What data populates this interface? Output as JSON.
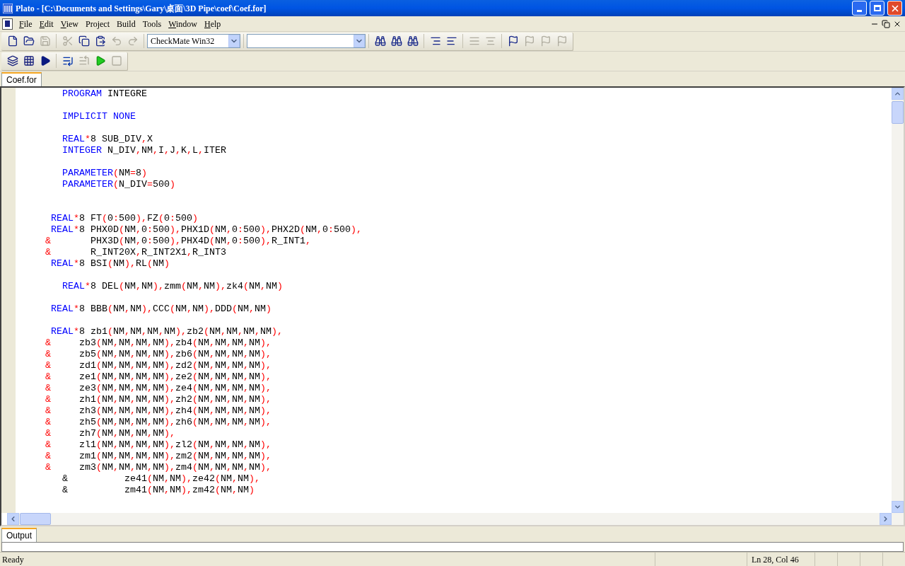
{
  "window": {
    "title": "Plato - [C:\\Documents and Settings\\Gary\\桌面\\3D Pipe\\coef\\Coef.for]"
  },
  "menu": [
    {
      "label": "File",
      "mnemonic": true
    },
    {
      "label": "Edit",
      "mnemonic": true
    },
    {
      "label": "View",
      "mnemonic": true
    },
    {
      "label": "Project",
      "mnemonic": false
    },
    {
      "label": "Build",
      "mnemonic": false
    },
    {
      "label": "Tools",
      "mnemonic": false
    },
    {
      "label": "Window",
      "mnemonic": true
    },
    {
      "label": "Help",
      "mnemonic": true
    }
  ],
  "toolbar_file": [
    {
      "disabled": false
    },
    {
      "disabled": false
    },
    {
      "disabled": true
    },
    {
      "disabled": true
    },
    {
      "disabled": false
    },
    {
      "disabled": false
    },
    {
      "disabled": true
    },
    {
      "disabled": true
    }
  ],
  "configuration_dropdown": {
    "value": "CheckMate Win32"
  },
  "toolbar_edit": [
    {
      "disabled": false
    },
    {
      "disabled": false
    },
    {
      "disabled": false
    },
    {
      "disabled": false
    },
    {
      "disabled": false
    },
    {
      "disabled": true
    },
    {
      "disabled": true
    },
    {
      "disabled": false
    },
    {
      "disabled": true
    },
    {
      "disabled": true
    },
    {
      "disabled": true
    }
  ],
  "toolbar_build": [
    {
      "disabled": false
    },
    {
      "disabled": false
    },
    {
      "disabled": false
    },
    {
      "disabled": false
    },
    {
      "disabled": true
    },
    {
      "disabled": false
    },
    {
      "disabled": true
    }
  ],
  "editor_tabs": [
    {
      "label": "Coef.for",
      "selected": true
    }
  ],
  "code_lines": [
    {
      "kind": "code",
      "tokens": [
        {
          "kind": "keyword",
          "text": "        PROGRAM"
        },
        {
          "kind": "name",
          "text": " INTEGRE"
        }
      ]
    },
    {
      "kind": "blank"
    },
    {
      "kind": "code",
      "tokens": [
        {
          "kind": "keyword",
          "text": "        IMPLICIT NONE"
        }
      ]
    },
    {
      "kind": "blank"
    },
    {
      "kind": "code",
      "tokens": [
        {
          "kind": "keyword",
          "text": "        REAL"
        },
        {
          "kind": "symbol",
          "text": "*"
        },
        {
          "kind": "name",
          "text": "8 SUB_DIV"
        },
        {
          "kind": "symbol",
          "text": ","
        },
        {
          "kind": "name",
          "text": "X"
        }
      ]
    },
    {
      "kind": "code",
      "tokens": [
        {
          "kind": "keyword",
          "text": "        INTEGER"
        },
        {
          "kind": "name",
          "text": " N_DIV"
        },
        {
          "kind": "symbol",
          "text": ","
        },
        {
          "kind": "name",
          "text": "NM"
        },
        {
          "kind": "symbol",
          "text": ","
        },
        {
          "kind": "name",
          "text": "I"
        },
        {
          "kind": "symbol",
          "text": ","
        },
        {
          "kind": "name",
          "text": "J"
        },
        {
          "kind": "symbol",
          "text": ","
        },
        {
          "kind": "name",
          "text": "K"
        },
        {
          "kind": "symbol",
          "text": ","
        },
        {
          "kind": "name",
          "text": "L"
        },
        {
          "kind": "symbol",
          "text": ","
        },
        {
          "kind": "name",
          "text": "ITER"
        }
      ]
    },
    {
      "kind": "blank"
    },
    {
      "kind": "code",
      "tokens": [
        {
          "kind": "keyword",
          "text": "        PARAMETER"
        },
        {
          "kind": "symbol",
          "text": "("
        },
        {
          "kind": "name",
          "text": "NM"
        },
        {
          "kind": "symbol",
          "text": "="
        },
        {
          "kind": "name",
          "text": "8"
        },
        {
          "kind": "symbol",
          "text": ")"
        }
      ]
    },
    {
      "kind": "code",
      "tokens": [
        {
          "kind": "keyword",
          "text": "        PARAMETER"
        },
        {
          "kind": "symbol",
          "text": "("
        },
        {
          "kind": "name",
          "text": "N_DIV"
        },
        {
          "kind": "symbol",
          "text": "="
        },
        {
          "kind": "name",
          "text": "500"
        },
        {
          "kind": "symbol",
          "text": ")"
        }
      ]
    },
    {
      "kind": "blank"
    },
    {
      "kind": "blank"
    },
    {
      "kind": "code",
      "tokens": [
        {
          "kind": "keyword",
          "text": "      REAL"
        },
        {
          "kind": "symbol",
          "text": "*"
        },
        {
          "kind": "name",
          "text": "8 FT"
        },
        {
          "kind": "symbol",
          "text": "("
        },
        {
          "kind": "name",
          "text": "0"
        },
        {
          "kind": "symbol",
          "text": ":"
        },
        {
          "kind": "name",
          "text": "500"
        },
        {
          "kind": "symbol",
          "text": "),"
        },
        {
          "kind": "name",
          "text": "FZ"
        },
        {
          "kind": "symbol",
          "text": "("
        },
        {
          "kind": "name",
          "text": "0"
        },
        {
          "kind": "symbol",
          "text": ":"
        },
        {
          "kind": "name",
          "text": "500"
        },
        {
          "kind": "symbol",
          "text": ")"
        }
      ]
    },
    {
      "kind": "code",
      "tokens": [
        {
          "kind": "keyword",
          "text": "      REAL"
        },
        {
          "kind": "symbol",
          "text": "*"
        },
        {
          "kind": "name",
          "text": "8 PHX0D"
        },
        {
          "kind": "symbol",
          "text": "("
        },
        {
          "kind": "name",
          "text": "NM"
        },
        {
          "kind": "symbol",
          "text": ","
        },
        {
          "kind": "name",
          "text": "0"
        },
        {
          "kind": "symbol",
          "text": ":"
        },
        {
          "kind": "name",
          "text": "500"
        },
        {
          "kind": "symbol",
          "text": "),"
        },
        {
          "kind": "name",
          "text": "PHX1D"
        },
        {
          "kind": "symbol",
          "text": "("
        },
        {
          "kind": "name",
          "text": "NM"
        },
        {
          "kind": "symbol",
          "text": ","
        },
        {
          "kind": "name",
          "text": "0"
        },
        {
          "kind": "symbol",
          "text": ":"
        },
        {
          "kind": "name",
          "text": "500"
        },
        {
          "kind": "symbol",
          "text": "),"
        },
        {
          "kind": "name",
          "text": "PHX2D"
        },
        {
          "kind": "symbol",
          "text": "("
        },
        {
          "kind": "name",
          "text": "NM"
        },
        {
          "kind": "symbol",
          "text": ","
        },
        {
          "kind": "name",
          "text": "0"
        },
        {
          "kind": "symbol",
          "text": ":"
        },
        {
          "kind": "name",
          "text": "500"
        },
        {
          "kind": "symbol",
          "text": "),"
        }
      ]
    },
    {
      "kind": "code",
      "tokens": [
        {
          "kind": "symbol",
          "text": "     &"
        },
        {
          "kind": "name",
          "text": "       PHX3D"
        },
        {
          "kind": "symbol",
          "text": "("
        },
        {
          "kind": "name",
          "text": "NM"
        },
        {
          "kind": "symbol",
          "text": ","
        },
        {
          "kind": "name",
          "text": "0"
        },
        {
          "kind": "symbol",
          "text": ":"
        },
        {
          "kind": "name",
          "text": "500"
        },
        {
          "kind": "symbol",
          "text": "),"
        },
        {
          "kind": "name",
          "text": "PHX4D"
        },
        {
          "kind": "symbol",
          "text": "("
        },
        {
          "kind": "name",
          "text": "NM"
        },
        {
          "kind": "symbol",
          "text": ","
        },
        {
          "kind": "name",
          "text": "0"
        },
        {
          "kind": "symbol",
          "text": ":"
        },
        {
          "kind": "name",
          "text": "500"
        },
        {
          "kind": "symbol",
          "text": "),"
        },
        {
          "kind": "name",
          "text": "R_INT1"
        },
        {
          "kind": "symbol",
          "text": ","
        }
      ]
    },
    {
      "kind": "code",
      "tokens": [
        {
          "kind": "symbol",
          "text": "     &"
        },
        {
          "kind": "name",
          "text": "       R_INT20X"
        },
        {
          "kind": "symbol",
          "text": ","
        },
        {
          "kind": "name",
          "text": "R_INT2X1"
        },
        {
          "kind": "symbol",
          "text": ","
        },
        {
          "kind": "name",
          "text": "R_INT3"
        }
      ]
    },
    {
      "kind": "code",
      "tokens": [
        {
          "kind": "keyword",
          "text": "      REAL"
        },
        {
          "kind": "symbol",
          "text": "*"
        },
        {
          "kind": "name",
          "text": "8 BSI"
        },
        {
          "kind": "symbol",
          "text": "("
        },
        {
          "kind": "name",
          "text": "NM"
        },
        {
          "kind": "symbol",
          "text": "),"
        },
        {
          "kind": "name",
          "text": "RL"
        },
        {
          "kind": "symbol",
          "text": "("
        },
        {
          "kind": "name",
          "text": "NM"
        },
        {
          "kind": "symbol",
          "text": ")"
        }
      ]
    },
    {
      "kind": "blank"
    },
    {
      "kind": "code",
      "tokens": [
        {
          "kind": "keyword",
          "text": "        REAL"
        },
        {
          "kind": "symbol",
          "text": "*"
        },
        {
          "kind": "name",
          "text": "8 DEL"
        },
        {
          "kind": "symbol",
          "text": "("
        },
        {
          "kind": "name",
          "text": "NM"
        },
        {
          "kind": "symbol",
          "text": ","
        },
        {
          "kind": "name",
          "text": "NM"
        },
        {
          "kind": "symbol",
          "text": "),"
        },
        {
          "kind": "name",
          "text": "zmm"
        },
        {
          "kind": "symbol",
          "text": "("
        },
        {
          "kind": "name",
          "text": "NM"
        },
        {
          "kind": "symbol",
          "text": ","
        },
        {
          "kind": "name",
          "text": "NM"
        },
        {
          "kind": "symbol",
          "text": "),"
        },
        {
          "kind": "name",
          "text": "zk4"
        },
        {
          "kind": "symbol",
          "text": "("
        },
        {
          "kind": "name",
          "text": "NM"
        },
        {
          "kind": "symbol",
          "text": ","
        },
        {
          "kind": "name",
          "text": "NM"
        },
        {
          "kind": "symbol",
          "text": ")"
        }
      ]
    },
    {
      "kind": "blank"
    },
    {
      "kind": "code",
      "tokens": [
        {
          "kind": "keyword",
          "text": "      REAL"
        },
        {
          "kind": "symbol",
          "text": "*"
        },
        {
          "kind": "name",
          "text": "8 BBB"
        },
        {
          "kind": "symbol",
          "text": "("
        },
        {
          "kind": "name",
          "text": "NM"
        },
        {
          "kind": "symbol",
          "text": ","
        },
        {
          "kind": "name",
          "text": "NM"
        },
        {
          "kind": "symbol",
          "text": "),"
        },
        {
          "kind": "name",
          "text": "CCC"
        },
        {
          "kind": "symbol",
          "text": "("
        },
        {
          "kind": "name",
          "text": "NM"
        },
        {
          "kind": "symbol",
          "text": ","
        },
        {
          "kind": "name",
          "text": "NM"
        },
        {
          "kind": "symbol",
          "text": "),"
        },
        {
          "kind": "name",
          "text": "DDD"
        },
        {
          "kind": "symbol",
          "text": "("
        },
        {
          "kind": "name",
          "text": "NM"
        },
        {
          "kind": "symbol",
          "text": ","
        },
        {
          "kind": "name",
          "text": "NM"
        },
        {
          "kind": "symbol",
          "text": ")"
        }
      ]
    },
    {
      "kind": "blank"
    },
    {
      "kind": "code",
      "tokens": [
        {
          "kind": "keyword",
          "text": "      REAL"
        },
        {
          "kind": "symbol",
          "text": "*"
        },
        {
          "kind": "name",
          "text": "8 zb1"
        },
        {
          "kind": "symbol",
          "text": "("
        },
        {
          "kind": "name",
          "text": "NM"
        },
        {
          "kind": "symbol",
          "text": ","
        },
        {
          "kind": "name",
          "text": "NM"
        },
        {
          "kind": "symbol",
          "text": ","
        },
        {
          "kind": "name",
          "text": "NM"
        },
        {
          "kind": "symbol",
          "text": ","
        },
        {
          "kind": "name",
          "text": "NM"
        },
        {
          "kind": "symbol",
          "text": "),"
        },
        {
          "kind": "name",
          "text": "zb2"
        },
        {
          "kind": "symbol",
          "text": "("
        },
        {
          "kind": "name",
          "text": "NM"
        },
        {
          "kind": "symbol",
          "text": ","
        },
        {
          "kind": "name",
          "text": "NM"
        },
        {
          "kind": "symbol",
          "text": ","
        },
        {
          "kind": "name",
          "text": "NM"
        },
        {
          "kind": "symbol",
          "text": ","
        },
        {
          "kind": "name",
          "text": "NM"
        },
        {
          "kind": "symbol",
          "text": "),"
        }
      ]
    },
    {
      "kind": "code",
      "tokens": [
        {
          "kind": "symbol",
          "text": "     &"
        },
        {
          "kind": "name",
          "text": "     zb3"
        },
        {
          "kind": "symbol",
          "text": "("
        },
        {
          "kind": "name",
          "text": "NM"
        },
        {
          "kind": "symbol",
          "text": ","
        },
        {
          "kind": "name",
          "text": "NM"
        },
        {
          "kind": "symbol",
          "text": ","
        },
        {
          "kind": "name",
          "text": "NM"
        },
        {
          "kind": "symbol",
          "text": ","
        },
        {
          "kind": "name",
          "text": "NM"
        },
        {
          "kind": "symbol",
          "text": "),"
        },
        {
          "kind": "name",
          "text": "zb4"
        },
        {
          "kind": "symbol",
          "text": "("
        },
        {
          "kind": "name",
          "text": "NM"
        },
        {
          "kind": "symbol",
          "text": ","
        },
        {
          "kind": "name",
          "text": "NM"
        },
        {
          "kind": "symbol",
          "text": ","
        },
        {
          "kind": "name",
          "text": "NM"
        },
        {
          "kind": "symbol",
          "text": ","
        },
        {
          "kind": "name",
          "text": "NM"
        },
        {
          "kind": "symbol",
          "text": "),"
        }
      ]
    },
    {
      "kind": "code",
      "tokens": [
        {
          "kind": "symbol",
          "text": "     &"
        },
        {
          "kind": "name",
          "text": "     zb5"
        },
        {
          "kind": "symbol",
          "text": "("
        },
        {
          "kind": "name",
          "text": "NM"
        },
        {
          "kind": "symbol",
          "text": ","
        },
        {
          "kind": "name",
          "text": "NM"
        },
        {
          "kind": "symbol",
          "text": ","
        },
        {
          "kind": "name",
          "text": "NM"
        },
        {
          "kind": "symbol",
          "text": ","
        },
        {
          "kind": "name",
          "text": "NM"
        },
        {
          "kind": "symbol",
          "text": "),"
        },
        {
          "kind": "name",
          "text": "zb6"
        },
        {
          "kind": "symbol",
          "text": "("
        },
        {
          "kind": "name",
          "text": "NM"
        },
        {
          "kind": "symbol",
          "text": ","
        },
        {
          "kind": "name",
          "text": "NM"
        },
        {
          "kind": "symbol",
          "text": ","
        },
        {
          "kind": "name",
          "text": "NM"
        },
        {
          "kind": "symbol",
          "text": ","
        },
        {
          "kind": "name",
          "text": "NM"
        },
        {
          "kind": "symbol",
          "text": "),"
        }
      ]
    },
    {
      "kind": "code",
      "tokens": [
        {
          "kind": "symbol",
          "text": "     &"
        },
        {
          "kind": "name",
          "text": "     zd1"
        },
        {
          "kind": "symbol",
          "text": "("
        },
        {
          "kind": "name",
          "text": "NM"
        },
        {
          "kind": "symbol",
          "text": ","
        },
        {
          "kind": "name",
          "text": "NM"
        },
        {
          "kind": "symbol",
          "text": ","
        },
        {
          "kind": "name",
          "text": "NM"
        },
        {
          "kind": "symbol",
          "text": ","
        },
        {
          "kind": "name",
          "text": "NM"
        },
        {
          "kind": "symbol",
          "text": "),"
        },
        {
          "kind": "name",
          "text": "zd2"
        },
        {
          "kind": "symbol",
          "text": "("
        },
        {
          "kind": "name",
          "text": "NM"
        },
        {
          "kind": "symbol",
          "text": ","
        },
        {
          "kind": "name",
          "text": "NM"
        },
        {
          "kind": "symbol",
          "text": ","
        },
        {
          "kind": "name",
          "text": "NM"
        },
        {
          "kind": "symbol",
          "text": ","
        },
        {
          "kind": "name",
          "text": "NM"
        },
        {
          "kind": "symbol",
          "text": "),"
        }
      ]
    },
    {
      "kind": "code",
      "tokens": [
        {
          "kind": "symbol",
          "text": "     &"
        },
        {
          "kind": "name",
          "text": "     ze1"
        },
        {
          "kind": "symbol",
          "text": "("
        },
        {
          "kind": "name",
          "text": "NM"
        },
        {
          "kind": "symbol",
          "text": ","
        },
        {
          "kind": "name",
          "text": "NM"
        },
        {
          "kind": "symbol",
          "text": ","
        },
        {
          "kind": "name",
          "text": "NM"
        },
        {
          "kind": "symbol",
          "text": ","
        },
        {
          "kind": "name",
          "text": "NM"
        },
        {
          "kind": "symbol",
          "text": "),"
        },
        {
          "kind": "name",
          "text": "ze2"
        },
        {
          "kind": "symbol",
          "text": "("
        },
        {
          "kind": "name",
          "text": "NM"
        },
        {
          "kind": "symbol",
          "text": ","
        },
        {
          "kind": "name",
          "text": "NM"
        },
        {
          "kind": "symbol",
          "text": ","
        },
        {
          "kind": "name",
          "text": "NM"
        },
        {
          "kind": "symbol",
          "text": ","
        },
        {
          "kind": "name",
          "text": "NM"
        },
        {
          "kind": "symbol",
          "text": "),"
        }
      ]
    },
    {
      "kind": "code",
      "tokens": [
        {
          "kind": "symbol",
          "text": "     &"
        },
        {
          "kind": "name",
          "text": "     ze3"
        },
        {
          "kind": "symbol",
          "text": "("
        },
        {
          "kind": "name",
          "text": "NM"
        },
        {
          "kind": "symbol",
          "text": ","
        },
        {
          "kind": "name",
          "text": "NM"
        },
        {
          "kind": "symbol",
          "text": ","
        },
        {
          "kind": "name",
          "text": "NM"
        },
        {
          "kind": "symbol",
          "text": ","
        },
        {
          "kind": "name",
          "text": "NM"
        },
        {
          "kind": "symbol",
          "text": "),"
        },
        {
          "kind": "name",
          "text": "ze4"
        },
        {
          "kind": "symbol",
          "text": "("
        },
        {
          "kind": "name",
          "text": "NM"
        },
        {
          "kind": "symbol",
          "text": ","
        },
        {
          "kind": "name",
          "text": "NM"
        },
        {
          "kind": "symbol",
          "text": ","
        },
        {
          "kind": "name",
          "text": "NM"
        },
        {
          "kind": "symbol",
          "text": ","
        },
        {
          "kind": "name",
          "text": "NM"
        },
        {
          "kind": "symbol",
          "text": "),"
        }
      ]
    },
    {
      "kind": "code",
      "tokens": [
        {
          "kind": "symbol",
          "text": "     &"
        },
        {
          "kind": "name",
          "text": "     zh1"
        },
        {
          "kind": "symbol",
          "text": "("
        },
        {
          "kind": "name",
          "text": "NM"
        },
        {
          "kind": "symbol",
          "text": ","
        },
        {
          "kind": "name",
          "text": "NM"
        },
        {
          "kind": "symbol",
          "text": ","
        },
        {
          "kind": "name",
          "text": "NM"
        },
        {
          "kind": "symbol",
          "text": ","
        },
        {
          "kind": "name",
          "text": "NM"
        },
        {
          "kind": "symbol",
          "text": "),"
        },
        {
          "kind": "name",
          "text": "zh2"
        },
        {
          "kind": "symbol",
          "text": "("
        },
        {
          "kind": "name",
          "text": "NM"
        },
        {
          "kind": "symbol",
          "text": ","
        },
        {
          "kind": "name",
          "text": "NM"
        },
        {
          "kind": "symbol",
          "text": ","
        },
        {
          "kind": "name",
          "text": "NM"
        },
        {
          "kind": "symbol",
          "text": ","
        },
        {
          "kind": "name",
          "text": "NM"
        },
        {
          "kind": "symbol",
          "text": "),"
        }
      ]
    },
    {
      "kind": "code",
      "tokens": [
        {
          "kind": "symbol",
          "text": "     &"
        },
        {
          "kind": "name",
          "text": "     zh3"
        },
        {
          "kind": "symbol",
          "text": "("
        },
        {
          "kind": "name",
          "text": "NM"
        },
        {
          "kind": "symbol",
          "text": ","
        },
        {
          "kind": "name",
          "text": "NM"
        },
        {
          "kind": "symbol",
          "text": ","
        },
        {
          "kind": "name",
          "text": "NM"
        },
        {
          "kind": "symbol",
          "text": ","
        },
        {
          "kind": "name",
          "text": "NM"
        },
        {
          "kind": "symbol",
          "text": "),"
        },
        {
          "kind": "name",
          "text": "zh4"
        },
        {
          "kind": "symbol",
          "text": "("
        },
        {
          "kind": "name",
          "text": "NM"
        },
        {
          "kind": "symbol",
          "text": ","
        },
        {
          "kind": "name",
          "text": "NM"
        },
        {
          "kind": "symbol",
          "text": ","
        },
        {
          "kind": "name",
          "text": "NM"
        },
        {
          "kind": "symbol",
          "text": ","
        },
        {
          "kind": "name",
          "text": "NM"
        },
        {
          "kind": "symbol",
          "text": "),"
        }
      ]
    },
    {
      "kind": "code",
      "tokens": [
        {
          "kind": "symbol",
          "text": "     &"
        },
        {
          "kind": "name",
          "text": "     zh5"
        },
        {
          "kind": "symbol",
          "text": "("
        },
        {
          "kind": "name",
          "text": "NM"
        },
        {
          "kind": "symbol",
          "text": ","
        },
        {
          "kind": "name",
          "text": "NM"
        },
        {
          "kind": "symbol",
          "text": ","
        },
        {
          "kind": "name",
          "text": "NM"
        },
        {
          "kind": "symbol",
          "text": ","
        },
        {
          "kind": "name",
          "text": "NM"
        },
        {
          "kind": "symbol",
          "text": "),"
        },
        {
          "kind": "name",
          "text": "zh6"
        },
        {
          "kind": "symbol",
          "text": "("
        },
        {
          "kind": "name",
          "text": "NM"
        },
        {
          "kind": "symbol",
          "text": ","
        },
        {
          "kind": "name",
          "text": "NM"
        },
        {
          "kind": "symbol",
          "text": ","
        },
        {
          "kind": "name",
          "text": "NM"
        },
        {
          "kind": "symbol",
          "text": ","
        },
        {
          "kind": "name",
          "text": "NM"
        },
        {
          "kind": "symbol",
          "text": "),"
        }
      ]
    },
    {
      "kind": "code",
      "tokens": [
        {
          "kind": "symbol",
          "text": "     &"
        },
        {
          "kind": "name",
          "text": "     zh7"
        },
        {
          "kind": "symbol",
          "text": "("
        },
        {
          "kind": "name",
          "text": "NM"
        },
        {
          "kind": "symbol",
          "text": ","
        },
        {
          "kind": "name",
          "text": "NM"
        },
        {
          "kind": "symbol",
          "text": ","
        },
        {
          "kind": "name",
          "text": "NM"
        },
        {
          "kind": "symbol",
          "text": ","
        },
        {
          "kind": "name",
          "text": "NM"
        },
        {
          "kind": "symbol",
          "text": "),"
        }
      ]
    },
    {
      "kind": "code",
      "tokens": [
        {
          "kind": "symbol",
          "text": "     &"
        },
        {
          "kind": "name",
          "text": "     zl1"
        },
        {
          "kind": "symbol",
          "text": "("
        },
        {
          "kind": "name",
          "text": "NM"
        },
        {
          "kind": "symbol",
          "text": ","
        },
        {
          "kind": "name",
          "text": "NM"
        },
        {
          "kind": "symbol",
          "text": ","
        },
        {
          "kind": "name",
          "text": "NM"
        },
        {
          "kind": "symbol",
          "text": ","
        },
        {
          "kind": "name",
          "text": "NM"
        },
        {
          "kind": "symbol",
          "text": "),"
        },
        {
          "kind": "name",
          "text": "zl2"
        },
        {
          "kind": "symbol",
          "text": "("
        },
        {
          "kind": "name",
          "text": "NM"
        },
        {
          "kind": "symbol",
          "text": ","
        },
        {
          "kind": "name",
          "text": "NM"
        },
        {
          "kind": "symbol",
          "text": ","
        },
        {
          "kind": "name",
          "text": "NM"
        },
        {
          "kind": "symbol",
          "text": ","
        },
        {
          "kind": "name",
          "text": "NM"
        },
        {
          "kind": "symbol",
          "text": "),"
        }
      ]
    },
    {
      "kind": "code",
      "tokens": [
        {
          "kind": "symbol",
          "text": "     &"
        },
        {
          "kind": "name",
          "text": "     zm1"
        },
        {
          "kind": "symbol",
          "text": "("
        },
        {
          "kind": "name",
          "text": "NM"
        },
        {
          "kind": "symbol",
          "text": ","
        },
        {
          "kind": "name",
          "text": "NM"
        },
        {
          "kind": "symbol",
          "text": ","
        },
        {
          "kind": "name",
          "text": "NM"
        },
        {
          "kind": "symbol",
          "text": ","
        },
        {
          "kind": "name",
          "text": "NM"
        },
        {
          "kind": "symbol",
          "text": "),"
        },
        {
          "kind": "name",
          "text": "zm2"
        },
        {
          "kind": "symbol",
          "text": "("
        },
        {
          "kind": "name",
          "text": "NM"
        },
        {
          "kind": "symbol",
          "text": ","
        },
        {
          "kind": "name",
          "text": "NM"
        },
        {
          "kind": "symbol",
          "text": ","
        },
        {
          "kind": "name",
          "text": "NM"
        },
        {
          "kind": "symbol",
          "text": ","
        },
        {
          "kind": "name",
          "text": "NM"
        },
        {
          "kind": "symbol",
          "text": "),"
        }
      ]
    },
    {
      "kind": "code",
      "tokens": [
        {
          "kind": "symbol",
          "text": "     &"
        },
        {
          "kind": "name",
          "text": "     zm3"
        },
        {
          "kind": "symbol",
          "text": "("
        },
        {
          "kind": "name",
          "text": "NM"
        },
        {
          "kind": "symbol",
          "text": ","
        },
        {
          "kind": "name",
          "text": "NM"
        },
        {
          "kind": "symbol",
          "text": ","
        },
        {
          "kind": "name",
          "text": "NM"
        },
        {
          "kind": "symbol",
          "text": ","
        },
        {
          "kind": "name",
          "text": "NM"
        },
        {
          "kind": "symbol",
          "text": "),"
        },
        {
          "kind": "name",
          "text": "zm4"
        },
        {
          "kind": "symbol",
          "text": "("
        },
        {
          "kind": "name",
          "text": "NM"
        },
        {
          "kind": "symbol",
          "text": ","
        },
        {
          "kind": "name",
          "text": "NM"
        },
        {
          "kind": "symbol",
          "text": ","
        },
        {
          "kind": "name",
          "text": "NM"
        },
        {
          "kind": "symbol",
          "text": ","
        },
        {
          "kind": "name",
          "text": "NM"
        },
        {
          "kind": "symbol",
          "text": "),"
        }
      ]
    },
    {
      "kind": "code",
      "tokens": [
        {
          "kind": "name",
          "text": "        &          ze41"
        },
        {
          "kind": "symbol",
          "text": "("
        },
        {
          "kind": "name",
          "text": "NM"
        },
        {
          "kind": "symbol",
          "text": ","
        },
        {
          "kind": "name",
          "text": "NM"
        },
        {
          "kind": "symbol",
          "text": "),"
        },
        {
          "kind": "name",
          "text": "ze42"
        },
        {
          "kind": "symbol",
          "text": "("
        },
        {
          "kind": "name",
          "text": "NM"
        },
        {
          "kind": "symbol",
          "text": ","
        },
        {
          "kind": "name",
          "text": "NM"
        },
        {
          "kind": "symbol",
          "text": "),"
        }
      ]
    },
    {
      "kind": "code",
      "tokens": [
        {
          "kind": "name",
          "text": "        &          zm41"
        },
        {
          "kind": "symbol",
          "text": "("
        },
        {
          "kind": "name",
          "text": "NM"
        },
        {
          "kind": "symbol",
          "text": ","
        },
        {
          "kind": "name",
          "text": "NM"
        },
        {
          "kind": "symbol",
          "text": "),"
        },
        {
          "kind": "name",
          "text": "zm42"
        },
        {
          "kind": "symbol",
          "text": "("
        },
        {
          "kind": "name",
          "text": "NM"
        },
        {
          "kind": "symbol",
          "text": ","
        },
        {
          "kind": "name",
          "text": "NM"
        },
        {
          "kind": "symbol",
          "text": ")"
        }
      ]
    }
  ],
  "output_tabs": [
    {
      "label": "Output",
      "selected": true
    }
  ],
  "status_bar": {
    "message": "Ready",
    "position": "Ln 28, Col 46"
  }
}
